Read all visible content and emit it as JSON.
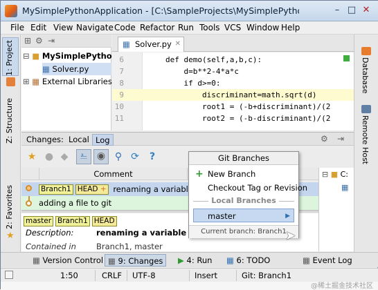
{
  "window": {
    "title": "MySimplePythonApplication - [C:\\SampleProjects\\MySimplePythonApplic..."
  },
  "menu": [
    "File",
    "Edit",
    "View",
    "Navigate",
    "Code",
    "Refactor",
    "Run",
    "Tools",
    "VCS",
    "Window",
    "Help"
  ],
  "left_strip": {
    "project": "1: Project",
    "structure": "Z: Structure",
    "favorites": "2: Favorites"
  },
  "right_strip": {
    "database": "Database",
    "remote": "Remote Host"
  },
  "project_tree": [
    {
      "label": "MySimplePytho",
      "icon": "folder-icon",
      "bold": true
    },
    {
      "label": "Solver.py",
      "icon": "python-file-icon",
      "selected": true
    },
    {
      "label": "External Libraries",
      "icon": "library-icon"
    }
  ],
  "editor": {
    "tab": "Solver.py",
    "lines": [
      {
        "n": "6",
        "code": "def demo(self,a,b,c):"
      },
      {
        "n": "7",
        "code": "    d=b**2-4*a*c"
      },
      {
        "n": "8",
        "code": "    if d>=0:"
      },
      {
        "n": "9",
        "code": "        discriminant=math.sqrt(d)",
        "highlight": true
      },
      {
        "n": "10",
        "code": "        root1 = (-b+discriminant)/(2"
      },
      {
        "n": "11",
        "code": "        root2 = (-b-discriminant)/(2"
      }
    ]
  },
  "changes": {
    "label": "Changes:",
    "tabs": [
      "Local",
      "Log"
    ],
    "active": "Log",
    "column_comment": "Comment"
  },
  "log_rows": [
    {
      "refs": [
        "Branch1",
        "HEAD"
      ],
      "comment": "renaming a variable",
      "selected": true
    },
    {
      "refs": [],
      "comment": "adding a file to git"
    }
  ],
  "details": {
    "refs": [
      "master",
      "Branch1",
      "HEAD"
    ],
    "description_label": "Description:",
    "description": "renaming a variable",
    "contained_label": "Contained in",
    "contained": "Branch1, master"
  },
  "git_popup": {
    "title": "Git Branches",
    "new_branch": "New Branch",
    "checkout": "Checkout Tag or Revision",
    "section": "Local Branches",
    "branch": "master",
    "footer": "Current branch: Branch1"
  },
  "bottom_tools": [
    {
      "label": "Version Control"
    },
    {
      "label": "9: Changes",
      "active": true
    },
    {
      "label": "4: Run"
    },
    {
      "label": "6: TODO"
    },
    {
      "label": "Event Log"
    }
  ],
  "status": {
    "pos": "1:50",
    "eol": "CRLF",
    "enc": "UTF-8",
    "mode": "Insert",
    "branch": "Git: Branch1"
  },
  "watermark": "@稀土掘金技术社区",
  "colors": {
    "accent": "#2f6fb3",
    "selection": "#c4d6ee",
    "ref_bg": "#f1f19a",
    "head_bg": "#f5e99a"
  }
}
